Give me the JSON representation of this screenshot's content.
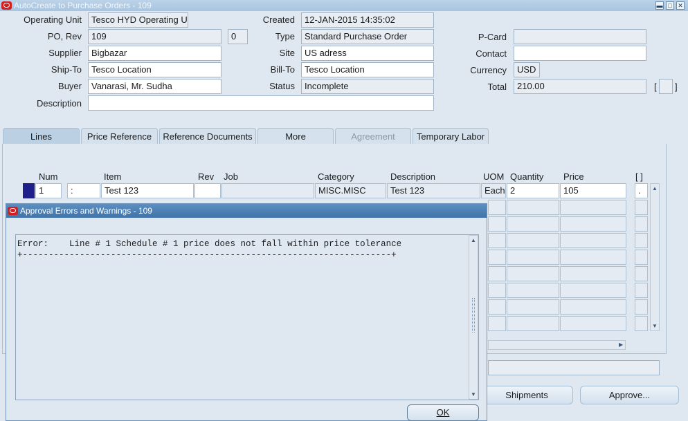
{
  "window": {
    "title": "AutoCreate to Purchase Orders - 109"
  },
  "header": {
    "operating_unit": {
      "label": "Operating Unit",
      "value": "Tesco HYD Operating U"
    },
    "po_rev": {
      "label": "PO, Rev",
      "po": "109",
      "rev": "0"
    },
    "supplier": {
      "label": "Supplier",
      "value": "Bigbazar"
    },
    "ship_to": {
      "label": "Ship-To",
      "value": "Tesco Location"
    },
    "buyer": {
      "label": "Buyer",
      "value": "Vanarasi, Mr. Sudha"
    },
    "description": {
      "label": "Description",
      "value": ""
    },
    "created": {
      "label": "Created",
      "value": "12-JAN-2015 14:35:02"
    },
    "type": {
      "label": "Type",
      "value": "Standard Purchase Order"
    },
    "site": {
      "label": "Site",
      "value": "US adress"
    },
    "bill_to": {
      "label": "Bill-To",
      "value": "Tesco Location"
    },
    "status": {
      "label": "Status",
      "value": "Incomplete"
    },
    "pcard": {
      "label": "P-Card",
      "value": ""
    },
    "contact": {
      "label": "Contact",
      "value": ""
    },
    "currency": {
      "label": "Currency",
      "value": "USD"
    },
    "total": {
      "label": "Total",
      "value": "210.00"
    }
  },
  "tabs": [
    "Lines",
    "Price Reference",
    "Reference Documents",
    "More",
    "Agreement",
    "Temporary Labor"
  ],
  "lines": {
    "columns": {
      "num": "Num",
      "item": "Item",
      "rev": "Rev",
      "job": "Job",
      "category": "Category",
      "description": "Description",
      "uom": "UOM",
      "quantity": "Quantity",
      "price": "Price",
      "flex": "[ ]"
    },
    "row1": {
      "num": "1",
      "type": ":",
      "item": "Test 123",
      "rev": "",
      "job": "",
      "category": "MISC.MISC",
      "description": "Test 123",
      "uom": "Each",
      "quantity": "2",
      "price": "105",
      "flex": "."
    }
  },
  "buttons": {
    "shipments": "Shipments",
    "approve": "Approve..."
  },
  "dialog": {
    "title": "Approval Errors and Warnings - 109",
    "message": "Error:    Line # 1 Schedule # 1 price does not fall within price tolerance\n+-----------------------------------------------------------------------+",
    "ok": "OK"
  }
}
